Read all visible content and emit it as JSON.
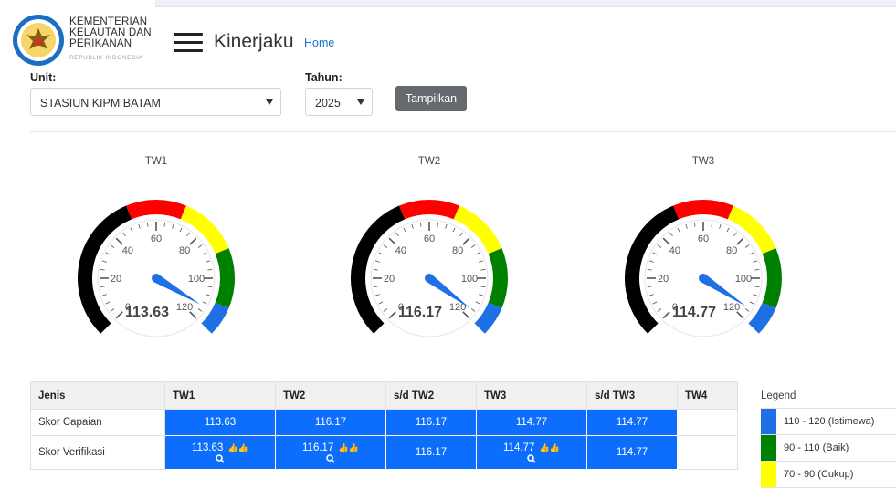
{
  "header": {
    "org_line1": "KEMENTERIAN",
    "org_line2": "KELAUTAN DAN",
    "org_line3": "PERIKANAN",
    "org_sub": "REPUBLIK INDONESIA",
    "app_title": "Kinerjaku",
    "home_link": "Home",
    "logo_icon": "garuda-emblem-icon",
    "menu_icon": "hamburger-menu-icon"
  },
  "filters": {
    "unit_label": "Unit:",
    "unit_value": "STASIUN KIPM BATAM",
    "year_label": "Tahun:",
    "year_value": "2025",
    "show_button": "Tampilkan"
  },
  "gauges": [
    {
      "title": "TW1",
      "value": 113.63,
      "value_text": "113.63"
    },
    {
      "title": "TW2",
      "value": 116.17,
      "value_text": "116.17"
    },
    {
      "title": "TW3",
      "value": 114.77,
      "value_text": "114.77"
    }
  ],
  "gauge_scale": {
    "min": 0,
    "max": 120,
    "tick_labels": [
      "0",
      "20",
      "40",
      "60",
      "80",
      "100",
      "120"
    ],
    "bands": [
      {
        "from": 0,
        "to": 50,
        "color": "#000000"
      },
      {
        "from": 50,
        "to": 70,
        "color": "#ff0000"
      },
      {
        "from": 70,
        "to": 90,
        "color": "#ffff00"
      },
      {
        "from": 90,
        "to": 110,
        "color": "#008000"
      },
      {
        "from": 110,
        "to": 120,
        "color": "#1f6fe5"
      }
    ]
  },
  "table": {
    "headers": [
      "Jenis",
      "TW1",
      "TW2",
      "s/d TW2",
      "TW3",
      "s/d TW3",
      "TW4"
    ],
    "rows": [
      {
        "label": "Skor Capaian",
        "cells": [
          "113.63",
          "116.17",
          "116.17",
          "114.77",
          "114.77",
          ""
        ]
      },
      {
        "label": "Skor Verifikasi",
        "cells": [
          "113.63",
          "116.17",
          "116.17",
          "114.77",
          "114.77",
          ""
        ]
      }
    ],
    "verified_icon": "thumbs-up-icon",
    "detail_icon": "search-icon"
  },
  "legend": {
    "title": "Legend",
    "items": [
      {
        "label": "110 - 120 (Istimewa)",
        "color": "#1f6fe5"
      },
      {
        "label": "90 - 110 (Baik)",
        "color": "#008000"
      },
      {
        "label": "70 - 90 (Cukup)",
        "color": "#ffff00"
      }
    ]
  }
}
